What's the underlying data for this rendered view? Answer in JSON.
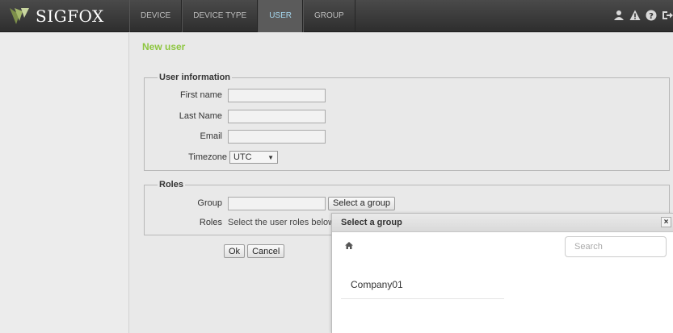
{
  "app": {
    "logo_text": "SIGFOX"
  },
  "nav": {
    "items": [
      {
        "label": "DEVICE",
        "active": false
      },
      {
        "label": "DEVICE TYPE",
        "active": false
      },
      {
        "label": "USER",
        "active": true
      },
      {
        "label": "GROUP",
        "active": false
      }
    ]
  },
  "top_icons": [
    "user-icon",
    "warning-icon",
    "help-icon",
    "logout-icon"
  ],
  "page": {
    "title": "New user"
  },
  "user_info": {
    "legend": "User information",
    "first_name_label": "First name",
    "first_name_value": "",
    "last_name_label": "Last Name",
    "last_name_value": "",
    "email_label": "Email",
    "email_value": "",
    "timezone_label": "Timezone",
    "timezone_value": "UTC"
  },
  "roles": {
    "legend": "Roles",
    "group_label": "Group",
    "group_value": "",
    "select_group_button": "Select a group",
    "roles_label": "Roles",
    "roles_hint": "Select the user roles below"
  },
  "actions": {
    "ok": "Ok",
    "cancel": "Cancel"
  },
  "modal": {
    "title": "Select a group",
    "close": "×",
    "search_placeholder": "Search",
    "items": [
      "Company01"
    ]
  },
  "colors": {
    "accent_green": "#8dc63f",
    "nav_active_text": "#a5d7ee",
    "topbar": "#3a3a3a"
  }
}
